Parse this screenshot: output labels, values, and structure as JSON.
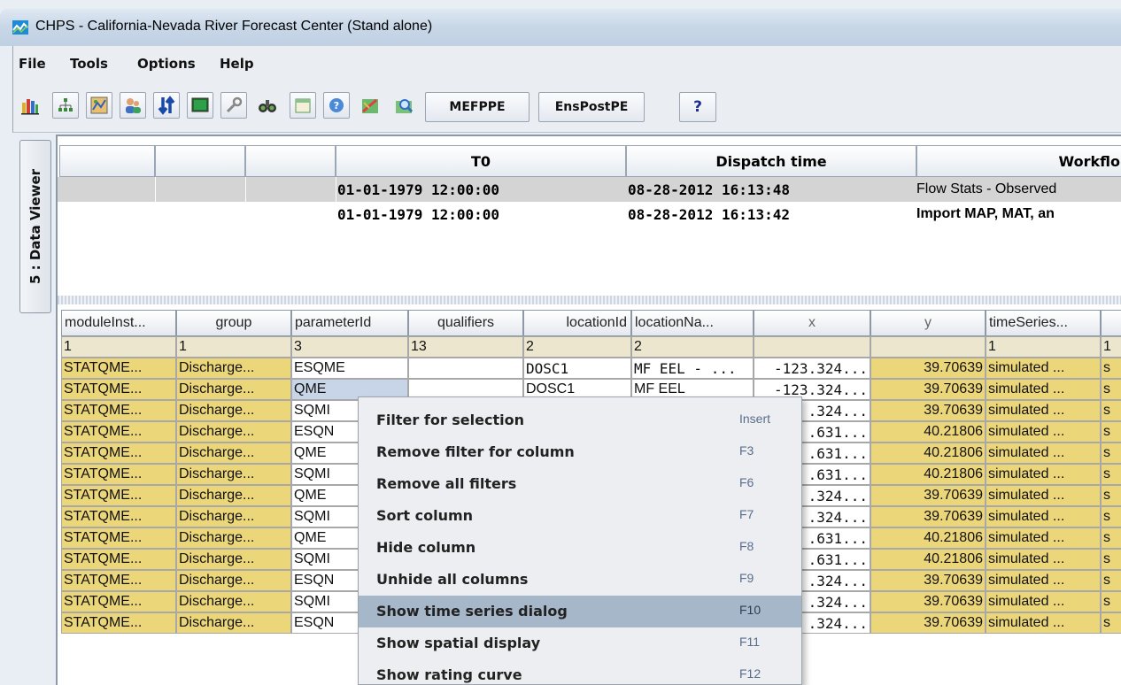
{
  "window": {
    "title": "CHPS - California-Nevada River Forecast Center  (Stand alone)"
  },
  "menubar": {
    "items": [
      "File",
      "Tools",
      "Options",
      "Help"
    ]
  },
  "toolbar": {
    "icons": [
      "bar-chart-icon",
      "hierarchy-icon",
      "map-icon",
      "users-icon",
      "transfer-arrows-icon",
      "monitor-icon",
      "wrench-icon",
      "binoculars-icon",
      "calendar-icon",
      "help-circle-icon",
      "edit-map-icon",
      "search-map-icon"
    ],
    "buttons": [
      "MEFPPE",
      "EnsPostPE",
      "?"
    ]
  },
  "side_tab": {
    "label": "5 : Data Viewer"
  },
  "task_table": {
    "headers": [
      "",
      "",
      "",
      "T0",
      "Dispatch time",
      "Workflo"
    ],
    "rows": [
      {
        "t0": "01-01-1979 12:00:00",
        "dispatch": "08-28-2012 16:13:48",
        "workflow": "Flow Stats - Observed",
        "selected": true,
        "bold": false
      },
      {
        "t0": "01-01-1979 12:00:00",
        "dispatch": "08-28-2012 16:13:42",
        "workflow": "Import MAP, MAT, an",
        "selected": false,
        "bold": true
      }
    ]
  },
  "grid": {
    "headers": [
      "moduleInst...",
      "group",
      "parameterId",
      "qualifiers",
      "locationId",
      "locationNa...",
      "x",
      "y",
      "timeSeries..."
    ],
    "filter_counts": [
      "1",
      "1",
      "3",
      "13",
      "2",
      "2",
      "",
      "",
      "1",
      "1"
    ],
    "rows": [
      [
        "STATQME...",
        "Discharge...",
        "ESQME",
        "",
        "DOSC1",
        "MF EEL - ...",
        "-123.324...",
        "39.70639",
        "simulated ..."
      ],
      [
        "STATQME...",
        "Discharge...",
        "QME",
        "",
        "DOSC1",
        "MF EEL",
        "-123.324...",
        "39.70639",
        "simulated ..."
      ],
      [
        "STATQME...",
        "Discharge...",
        "SQMI",
        "",
        "",
        "",
        ".324...",
        "39.70639",
        "simulated ..."
      ],
      [
        "STATQME...",
        "Discharge...",
        "ESQN",
        "",
        "",
        "",
        ".631...",
        "40.21806",
        "simulated ..."
      ],
      [
        "STATQME...",
        "Discharge...",
        "QME",
        "",
        "",
        "",
        ".631...",
        "40.21806",
        "simulated ..."
      ],
      [
        "STATQME...",
        "Discharge...",
        "SQMI",
        "",
        "",
        "",
        ".631...",
        "40.21806",
        "simulated ..."
      ],
      [
        "STATQME...",
        "Discharge...",
        "QME",
        "",
        "",
        "",
        ".324...",
        "39.70639",
        "simulated ..."
      ],
      [
        "STATQME...",
        "Discharge...",
        "SQMI",
        "",
        "",
        "",
        ".324...",
        "39.70639",
        "simulated ..."
      ],
      [
        "STATQME...",
        "Discharge...",
        "QME",
        "",
        "",
        "",
        ".631...",
        "40.21806",
        "simulated ..."
      ],
      [
        "STATQME...",
        "Discharge...",
        "SQMI",
        "",
        "",
        "",
        ".631...",
        "40.21806",
        "simulated ..."
      ],
      [
        "STATQME...",
        "Discharge...",
        "ESQN",
        "",
        "",
        "",
        ".324...",
        "39.70639",
        "simulated ..."
      ],
      [
        "STATQME...",
        "Discharge...",
        "SQMI",
        "",
        "",
        "",
        ".324...",
        "39.70639",
        "simulated ..."
      ],
      [
        "STATQME...",
        "Discharge...",
        "ESQN",
        "",
        "",
        "",
        ".324...",
        "39.70639",
        "simulated ..."
      ]
    ],
    "extra_col": "s"
  },
  "context_menu": {
    "items": [
      {
        "label": "Filter for selection",
        "key": "Insert",
        "highlight": false
      },
      {
        "label": "Remove filter for column",
        "key": "F3",
        "highlight": false
      },
      {
        "label": "Remove all filters",
        "key": "F6",
        "highlight": false
      },
      {
        "label": "Sort column",
        "key": "F7",
        "highlight": false
      },
      {
        "label": "Hide column",
        "key": "F8",
        "highlight": false
      },
      {
        "label": "Unhide all columns",
        "key": "F9",
        "highlight": false
      },
      {
        "label": "Show time series dialog",
        "key": "F10",
        "highlight": true
      },
      {
        "label": "Show spatial display",
        "key": "F11",
        "highlight": false
      },
      {
        "label": "Show rating curve",
        "key": "F12",
        "highlight": false
      }
    ]
  },
  "colors": {
    "row_yellow": "#ecd67a",
    "filter_row": "#ece6cf",
    "menu_highlight": "#a7b7ca",
    "selected_task_row": "#d4d4d4"
  }
}
